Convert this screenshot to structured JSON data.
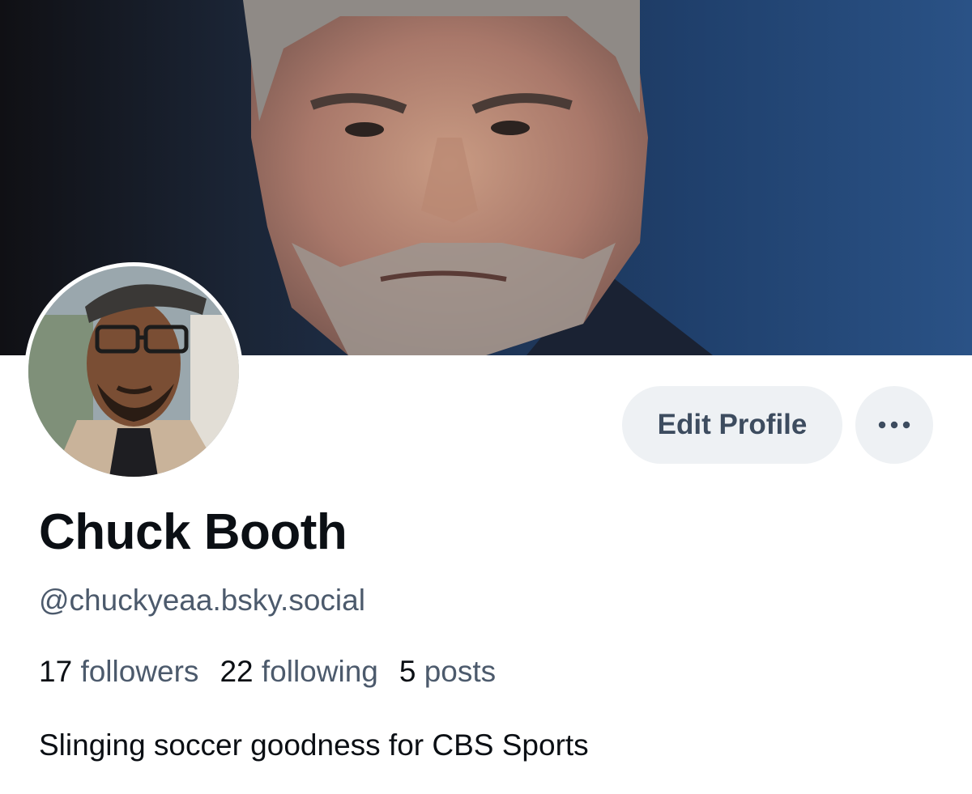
{
  "profile": {
    "display_name": "Chuck Booth",
    "handle": "@chuckyeaa.bsky.social",
    "bio": "Slinging soccer goodness for CBS Sports",
    "stats": {
      "followers_count": "17",
      "followers_label": "followers",
      "following_count": "22",
      "following_label": "following",
      "posts_count": "5",
      "posts_label": "posts"
    }
  },
  "actions": {
    "edit_profile_label": "Edit Profile",
    "more_icon": "ellipsis-icon"
  },
  "colors": {
    "text_primary": "#0b0f14",
    "text_secondary": "#4c5a6c",
    "button_bg": "#eef1f4"
  }
}
